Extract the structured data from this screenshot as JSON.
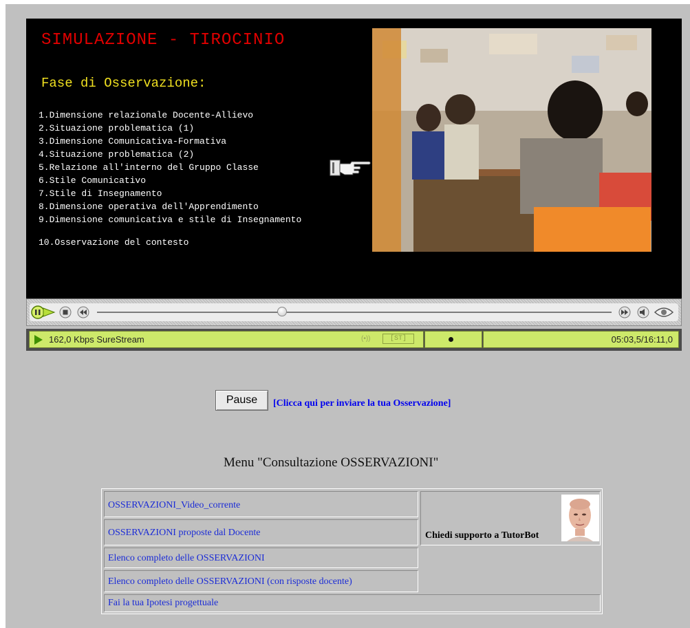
{
  "player": {
    "title": "SIMULAZIONE - TIROCINIO",
    "subtitle": "Fase di Osservazione:",
    "items": [
      "1.Dimensione relazionale Docente-Allievo",
      "2.Situazione problematica (1)",
      "3.Dimensione Comunicativa-Formativa",
      "4.Situazione problematica (2)",
      "5.Relazione all'interno del Gruppo Classe",
      "6.Stile Comunicativo",
      "7.Stile di Insegnamento",
      "8.Dimensione operativa dell'Apprendimento",
      "9.Dimensione comunicativa e stile di Insegnamento",
      "10.Osservazione del contesto"
    ],
    "seek_position_fraction": 0.36
  },
  "status": {
    "bitrate": "162,0 Kbps SureStream",
    "signal_icon": "(•))",
    "stereo_label": "[ST]",
    "time": "05:03,5/16:11,0"
  },
  "actions": {
    "pause_label": "Pause",
    "send_link": "[Clicca qui per inviare la tua Osservazione]"
  },
  "menu": {
    "title": "Menu \"Consultazione OSSERVAZIONI\"",
    "links": [
      "OSSERVAZIONI_Video_corrente",
      "OSSERVAZIONI proposte dal Docente",
      "Elenco completo delle OSSERVAZIONI",
      "Elenco completo delle OSSERVAZIONI (con risposte docente)",
      "Fai la tua Ipotesi progettuale"
    ],
    "tutor_label": "Chiedi supporto a TutorBot"
  },
  "colors": {
    "title": "#e00000",
    "subtitle": "#f0e020",
    "status_bar": "#cde96a",
    "link": "#1a2bd6"
  },
  "icons": [
    "pointing-hand-icon",
    "pause-icon",
    "stop-icon",
    "rewind-icon",
    "fast-forward-icon",
    "volume-icon",
    "realplayer-logo-icon",
    "play-triangle-icon",
    "tutorbot-avatar-icon"
  ]
}
